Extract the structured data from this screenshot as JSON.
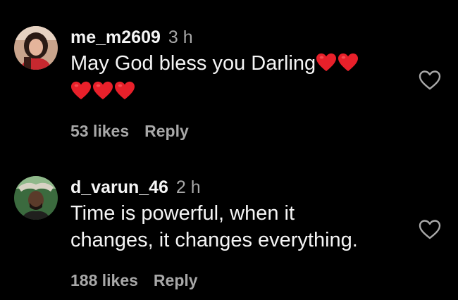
{
  "comments": [
    {
      "username": "me_m2609",
      "time": "3 h",
      "text": "May God bless you Darling",
      "likes": "53 likes",
      "reply_label": "Reply",
      "heart_emoji_count_line1": 2,
      "heart_emoji_count_line2": 3,
      "heart_emoji": "❤️",
      "like_icon": "heart-outline-icon"
    },
    {
      "username": "d_varun_46",
      "time": "2 h",
      "text_line1": "Time is powerful, when it",
      "text_line2": "changes, it changes everything.",
      "likes": "188 likes",
      "reply_label": "Reply",
      "like_icon": "heart-outline-icon"
    }
  ],
  "colors": {
    "background": "#000000",
    "primary_text": "#f5f5f5",
    "secondary_text": "#a8a8a8",
    "heart_emoji": "#e8202a"
  }
}
